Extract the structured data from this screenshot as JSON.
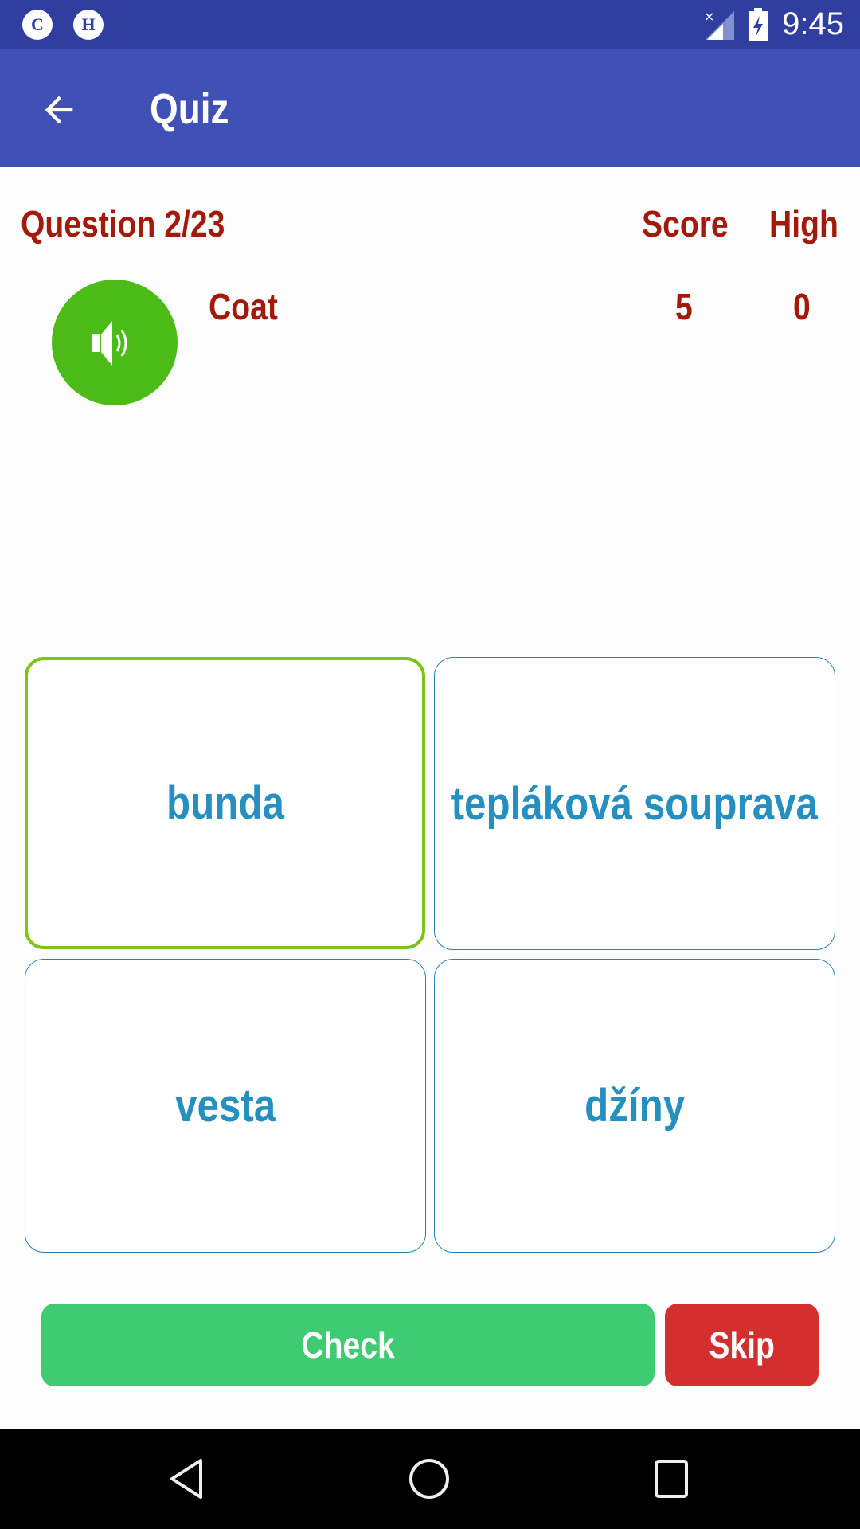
{
  "status_bar": {
    "notifications": [
      {
        "letter": "C",
        "icon": "c-notification-icon"
      },
      {
        "letter": "H",
        "icon": "h-notification-icon"
      }
    ],
    "signal_icon": "signal-no-data-icon",
    "battery_icon": "battery-charging-icon",
    "time": "9:45"
  },
  "toolbar": {
    "back_icon": "arrow-back-icon",
    "title": "Quiz"
  },
  "quiz": {
    "question_label": "Question 2/23",
    "score_label": "Score",
    "high_label": "High",
    "score_value": "5",
    "high_value": "0",
    "word": "Coat",
    "speaker_icon": "speaker-icon",
    "options": [
      {
        "label": "bunda",
        "selected": true
      },
      {
        "label": "tepláková souprava",
        "selected": false
      },
      {
        "label": "vesta",
        "selected": false
      },
      {
        "label": "džíny",
        "selected": false
      }
    ],
    "check_label": "Check",
    "skip_label": "Skip"
  },
  "colors": {
    "primary": "#3f51b5",
    "primary_dark": "#303f9f",
    "accent_text": "#a31a0c",
    "option_text": "#2590bf",
    "selected_border": "#7cc417",
    "check": "#3ecb74",
    "skip": "#d32f2f",
    "speaker": "#4cbb17"
  },
  "nav_bar": {
    "back": "nav-back-icon",
    "home": "nav-home-icon",
    "recents": "nav-recents-icon"
  }
}
